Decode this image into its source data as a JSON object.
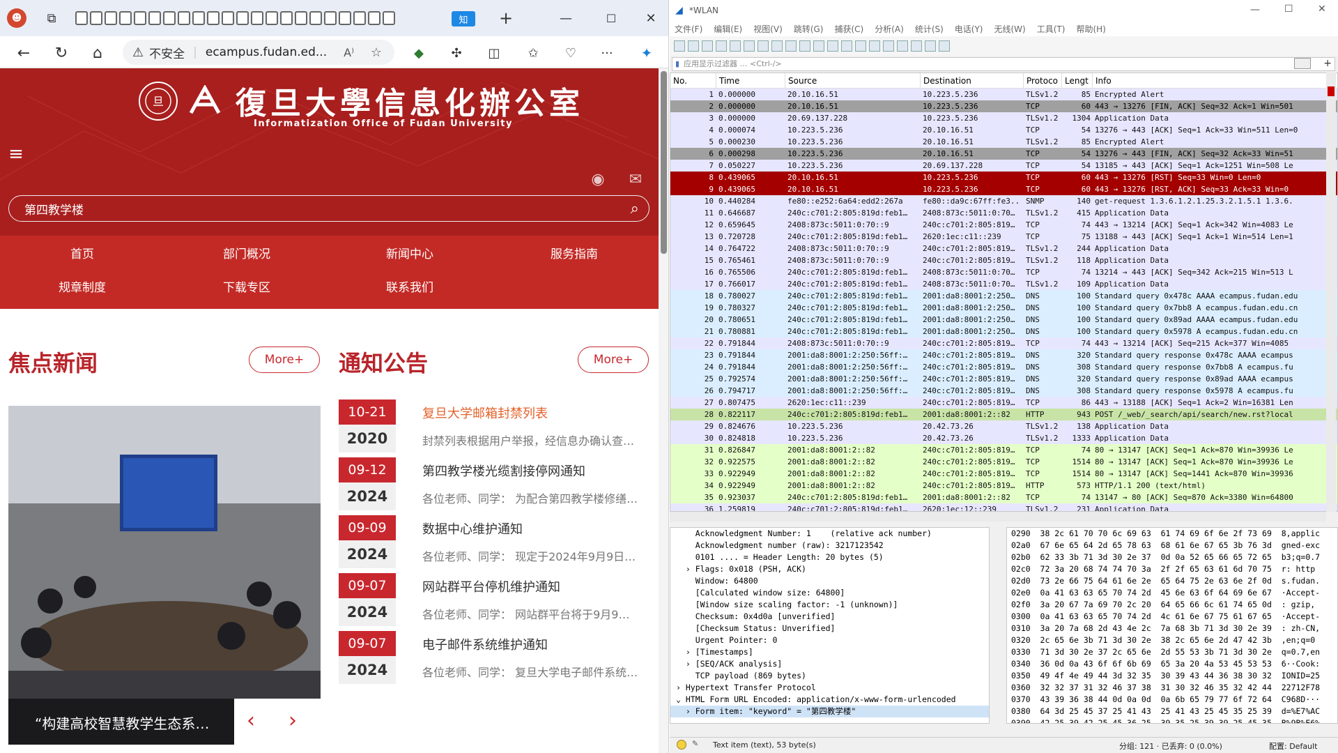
{
  "browser": {
    "url": "ecampus.fudan.ed...",
    "insecure_label": "不安全",
    "new_tab": "+",
    "tab_badge": "知"
  },
  "site": {
    "logo_cn": "復旦大學信息化辦公室",
    "logo_en": "Informatization Office of Fudan University",
    "search_value": "第四教学楼",
    "nav": [
      "首页",
      "部门概况",
      "新闻中心",
      "服务指南",
      "规章制度",
      "下载专区",
      "联系我们"
    ],
    "focus_title": "焦点新闻",
    "notice_title": "通知公告",
    "more": "More+",
    "photo_caption": "“构建高校智慧教学生态系…",
    "notices": [
      {
        "date": "10-21",
        "year": "2020",
        "title": "复旦大学邮箱封禁列表",
        "summary": "封禁列表根据用户举报，经信息办确认查…",
        "highlight": true
      },
      {
        "date": "09-12",
        "year": "2024",
        "title": "第四教学楼光缆割接停网通知",
        "summary": "各位老师、同学：  为配合第四教学楼修缮…",
        "highlight": false
      },
      {
        "date": "09-09",
        "year": "2024",
        "title": "数据中心维护通知",
        "summary": "各位老师、同学：  现定于2024年9月9日…",
        "highlight": false
      },
      {
        "date": "09-07",
        "year": "2024",
        "title": "网站群平台停机维护通知",
        "summary": "各位老师、同学：  网站群平台将于9月9…",
        "highlight": false
      },
      {
        "date": "09-07",
        "year": "2024",
        "title": "电子邮件系统维护通知",
        "summary": "各位老师、同学：  复旦大学电子邮件系统…",
        "highlight": false
      }
    ]
  },
  "wireshark": {
    "title": "*WLAN",
    "menu": [
      "文件(F)",
      "编辑(E)",
      "视图(V)",
      "跳转(G)",
      "捕获(C)",
      "分析(A)",
      "统计(S)",
      "电话(Y)",
      "无线(W)",
      "工具(T)",
      "帮助(H)"
    ],
    "filter_placeholder": "应用显示过滤器 … <Ctrl-/>",
    "columns": [
      "No.",
      "Time",
      "Source",
      "Destination",
      "Protocol",
      "Length",
      "Info"
    ],
    "column_labels_shown": [
      "No.",
      "Time",
      "Source",
      "Destination",
      "Protoco",
      "Lengt",
      "Info"
    ],
    "packets": [
      [
        "1",
        "0.000000",
        "20.10.16.51",
        "10.223.5.236",
        "TLSv1.2",
        "85",
        "Encrypted Alert",
        "tls"
      ],
      [
        "2",
        "0.000000",
        "20.10.16.51",
        "10.223.5.236",
        "TCP",
        "60",
        "443 → 13276 [FIN, ACK] Seq=32 Ack=1 Win=501",
        "gray"
      ],
      [
        "3",
        "0.000000",
        "20.69.137.228",
        "10.223.5.236",
        "TLSv1.2",
        "1304",
        "Application Data",
        "tls"
      ],
      [
        "4",
        "0.000074",
        "10.223.5.236",
        "20.10.16.51",
        "TCP",
        "54",
        "13276 → 443 [ACK] Seq=1 Ack=33 Win=511 Len=0",
        "tls"
      ],
      [
        "5",
        "0.000230",
        "10.223.5.236",
        "20.10.16.51",
        "TLSv1.2",
        "85",
        "Encrypted Alert",
        "tls"
      ],
      [
        "6",
        "0.000298",
        "10.223.5.236",
        "20.10.16.51",
        "TCP",
        "54",
        "13276 → 443 [FIN, ACK] Seq=32 Ack=33 Win=51",
        "gray"
      ],
      [
        "7",
        "0.050227",
        "10.223.5.236",
        "20.69.137.228",
        "TCP",
        "54",
        "13185 → 443 [ACK] Seq=1 Ack=1251 Win=508 Le",
        "tls"
      ],
      [
        "8",
        "0.439065",
        "20.10.16.51",
        "10.223.5.236",
        "TCP",
        "60",
        "443 → 13276 [RST] Seq=33 Win=0 Len=0",
        "red"
      ],
      [
        "9",
        "0.439065",
        "20.10.16.51",
        "10.223.5.236",
        "TCP",
        "60",
        "443 → 13276 [RST, ACK] Seq=33 Ack=33 Win=0",
        "red"
      ],
      [
        "10",
        "0.440284",
        "fe80::e252:6a64:edd2:267a",
        "fe80::da9c:67ff:fe3..",
        "SNMP",
        "140",
        "get-request 1.3.6.1.2.1.25.3.2.1.5.1 1.3.6.",
        "tls"
      ],
      [
        "11",
        "0.646687",
        "240c:c701:2:805:819d:feb1…",
        "2408:873c:5011:0:70…",
        "TLSv1.2",
        "415",
        "Application Data",
        "tls"
      ],
      [
        "12",
        "0.659645",
        "2408:873c:5011:0:70::9",
        "240c:c701:2:805:819…",
        "TCP",
        "74",
        "443 → 13214 [ACK] Seq=1 Ack=342 Win=4083 Le",
        "tls"
      ],
      [
        "13",
        "0.720728",
        "240c:c701:2:805:819d:feb1…",
        "2620:1ec:c11::239",
        "TCP",
        "75",
        "13188 → 443 [ACK] Seq=1 Ack=1 Win=514 Len=1",
        "tls"
      ],
      [
        "14",
        "0.764722",
        "2408:873c:5011:0:70::9",
        "240c:c701:2:805:819…",
        "TLSv1.2",
        "244",
        "Application Data",
        "tls"
      ],
      [
        "15",
        "0.765461",
        "2408:873c:5011:0:70::9",
        "240c:c701:2:805:819…",
        "TLSv1.2",
        "118",
        "Application Data",
        "tls"
      ],
      [
        "16",
        "0.765506",
        "240c:c701:2:805:819d:feb1…",
        "2408:873c:5011:0:70…",
        "TCP",
        "74",
        "13214 → 443 [ACK] Seq=342 Ack=215 Win=513 L",
        "tls"
      ],
      [
        "17",
        "0.766017",
        "240c:c701:2:805:819d:feb1…",
        "2408:873c:5011:0:70…",
        "TLSv1.2",
        "109",
        "Application Data",
        "tls"
      ],
      [
        "18",
        "0.780027",
        "240c:c701:2:805:819d:feb1…",
        "2001:da8:8001:2:250…",
        "DNS",
        "100",
        "Standard query 0x478c AAAA ecampus.fudan.edu",
        "dns"
      ],
      [
        "19",
        "0.780327",
        "240c:c701:2:805:819d:feb1…",
        "2001:da8:8001:2:250…",
        "DNS",
        "100",
        "Standard query 0x7bb8 A ecampus.fudan.edu.cn",
        "dns"
      ],
      [
        "20",
        "0.780651",
        "240c:c701:2:805:819d:feb1…",
        "2001:da8:8001:2:250…",
        "DNS",
        "100",
        "Standard query 0x89ad AAAA ecampus.fudan.edu",
        "dns"
      ],
      [
        "21",
        "0.780881",
        "240c:c701:2:805:819d:feb1…",
        "2001:da8:8001:2:250…",
        "DNS",
        "100",
        "Standard query 0x5978 A ecampus.fudan.edu.cn",
        "dns"
      ],
      [
        "22",
        "0.791844",
        "2408:873c:5011:0:70::9",
        "240c:c701:2:805:819…",
        "TCP",
        "74",
        "443 → 13214 [ACK] Seq=215 Ack=377 Win=4085",
        "tls"
      ],
      [
        "23",
        "0.791844",
        "2001:da8:8001:2:250:56ff:…",
        "240c:c701:2:805:819…",
        "DNS",
        "320",
        "Standard query response 0x478c AAAA ecampus",
        "dns"
      ],
      [
        "24",
        "0.791844",
        "2001:da8:8001:2:250:56ff:…",
        "240c:c701:2:805:819…",
        "DNS",
        "308",
        "Standard query response 0x7bb8 A ecampus.fu",
        "dns"
      ],
      [
        "25",
        "0.792574",
        "2001:da8:8001:2:250:56ff:…",
        "240c:c701:2:805:819…",
        "DNS",
        "320",
        "Standard query response 0x89ad AAAA ecampus",
        "dns"
      ],
      [
        "26",
        "0.794717",
        "2001:da8:8001:2:250:56ff:…",
        "240c:c701:2:805:819…",
        "DNS",
        "308",
        "Standard query response 0x5978 A ecampus.fu",
        "dns"
      ],
      [
        "27",
        "0.807475",
        "2620:1ec:c11::239",
        "240c:c701:2:805:819…",
        "TCP",
        "86",
        "443 → 13188 [ACK] Seq=1 Ack=2 Win=16381 Len",
        "tls"
      ],
      [
        "28",
        "0.822117",
        "240c:c701:2:805:819d:feb1…",
        "2001:da8:8001:2::82",
        "HTTP",
        "943",
        "POST /_web/_search/api/search/new.rst?local",
        "sel"
      ],
      [
        "29",
        "0.824676",
        "10.223.5.236",
        "20.42.73.26",
        "TLSv1.2",
        "138",
        "Application Data",
        "tls"
      ],
      [
        "30",
        "0.824818",
        "10.223.5.236",
        "20.42.73.26",
        "TLSv1.2",
        "1333",
        "Application Data",
        "tls"
      ],
      [
        "31",
        "0.826847",
        "2001:da8:8001:2::82",
        "240c:c701:2:805:819…",
        "TCP",
        "74",
        "80 → 13147 [ACK] Seq=1 Ack=870 Win=39936 Le",
        "http"
      ],
      [
        "32",
        "0.922575",
        "2001:da8:8001:2::82",
        "240c:c701:2:805:819…",
        "TCP",
        "1514",
        "80 → 13147 [ACK] Seq=1 Ack=870 Win=39936 Le",
        "http"
      ],
      [
        "33",
        "0.922949",
        "2001:da8:8001:2::82",
        "240c:c701:2:805:819…",
        "TCP",
        "1514",
        "80 → 13147 [ACK] Seq=1441 Ack=870 Win=39936",
        "http"
      ],
      [
        "34",
        "0.922949",
        "2001:da8:8001:2::82",
        "240c:c701:2:805:819…",
        "HTTP",
        "573",
        "HTTP/1.1 200   (text/html)",
        "http"
      ],
      [
        "35",
        "0.923037",
        "240c:c701:2:805:819d:feb1…",
        "2001:da8:8001:2::82",
        "TCP",
        "74",
        "13147 → 80 [ACK] Seq=870 Ack=3380 Win=64800",
        "http"
      ],
      [
        "36",
        "1.259819",
        "240c:c701:2:805:819d:feb1…",
        "2620:1ec:12::239",
        "TLSv1.2",
        "231",
        "Application Data",
        "tls"
      ]
    ],
    "details": [
      "    Acknowledgment Number: 1    (relative ack number)",
      "    Acknowledgment number (raw): 3217123542",
      "    0101 .... = Header Length: 20 bytes (5)",
      "  › Flags: 0x018 (PSH, ACK)",
      "    Window: 64800",
      "    [Calculated window size: 64800]",
      "    [Window size scaling factor: -1 (unknown)]",
      "    Checksum: 0x4d0a [unverified]",
      "    [Checksum Status: Unverified]",
      "    Urgent Pointer: 0",
      "  › [Timestamps]",
      "  › [SEQ/ACK analysis]",
      "    TCP payload (869 bytes)",
      "› Hypertext Transfer Protocol",
      "⌄ HTML Form URL Encoded: application/x-www-form-urlencoded",
      "  › Form item: \"keyword\" = \"第四教学楼\""
    ],
    "hex": [
      "0290  38 2c 61 70 70 6c 69 63  61 74 69 6f 6e 2f 73 69  8,applic",
      "02a0  67 6e 65 64 2d 65 78 63  68 61 6e 67 65 3b 76 3d  gned-exc",
      "02b0  62 33 3b 71 3d 30 2e 37  0d 0a 52 65 66 65 72 65  b3;q=0.7",
      "02c0  72 3a 20 68 74 74 70 3a  2f 2f 65 63 61 6d 70 75  r: http",
      "02d0  73 2e 66 75 64 61 6e 2e  65 64 75 2e 63 6e 2f 0d  s.fudan.",
      "02e0  0a 41 63 63 65 70 74 2d  45 6e 63 6f 64 69 6e 67  ·Accept-",
      "02f0  3a 20 67 7a 69 70 2c 20  64 65 66 6c 61 74 65 0d  : gzip,",
      "0300  0a 41 63 63 65 70 74 2d  4c 61 6e 67 75 61 67 65  ·Accept-",
      "0310  3a 20 7a 68 2d 43 4e 2c  7a 68 3b 71 3d 30 2e 39  : zh-CN,",
      "0320  2c 65 6e 3b 71 3d 30 2e  38 2c 65 6e 2d 47 42 3b  ,en;q=0",
      "0330  71 3d 30 2e 37 2c 65 6e  2d 55 53 3b 71 3d 30 2e  q=0.7,en",
      "0340  36 0d 0a 43 6f 6f 6b 69  65 3a 20 4a 53 45 53 53  6··Cook:",
      "0350  49 4f 4e 49 44 3d 32 35  30 39 43 44 36 38 30 32  IONID=25",
      "0360  32 32 37 31 32 46 37 38  31 30 32 46 35 32 42 44  22712F78",
      "0370  43 39 36 38 44 0d 0a 0d  0a 6b 65 79 77 6f 72 64  C968D···",
      "0380  64 3d 25 45 37 25 41 43  25 41 43 25 45 35 25 39  d=%E7%AC",
      "0390  42 25 39 42 25 45 36 25  39 35 25 39 39 25 45 35  B%9B%E6%",
      "03a0  25 41 44 25 41 36 25 45  36 25 41 35 25 42 43     %AD%A6%E"
    ],
    "status_text": "Text item (text), 53 byte(s)",
    "status_stats": "分组: 121 · 已丢弃: 0 (0.0%)",
    "status_profile": "配置: Default"
  },
  "colors": {
    "tls": "#e7e6ff",
    "gray": "#a0a0a0",
    "red": "#a40000",
    "dns": "#daeeff",
    "http": "#e4ffc7",
    "sel": "#c8e3a6",
    "fudan_red": "#a81f1e"
  }
}
